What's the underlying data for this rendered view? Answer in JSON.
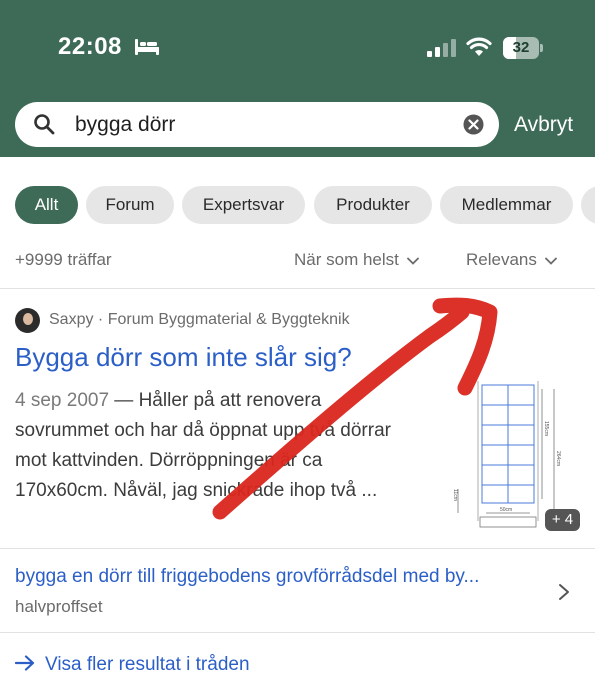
{
  "status_bar": {
    "time": "22:08",
    "battery": "32",
    "icons": [
      "bed-icon",
      "signal-icon",
      "wifi-icon",
      "battery-icon"
    ]
  },
  "search": {
    "query": "bygga dörr",
    "cancel_label": "Avbryt"
  },
  "filters": {
    "chips": [
      "Allt",
      "Forum",
      "Expertsvar",
      "Produkter",
      "Medlemmar"
    ],
    "active": "Allt"
  },
  "results_meta": {
    "hits": "+9999 träffar",
    "time_filter": "När som helst",
    "sort": "Relevans"
  },
  "result": {
    "author": "Saxpy",
    "source": "Saxpy · Forum Byggmaterial & Byggteknik",
    "title": "Bygga dörr som inte slår sig?",
    "date": "4 sep 2007",
    "snippet": " — Håller på att renovera sovrummet och har då öppnat upp två dörrar mot kattvinden. Dörröppningen är ca 170x60cm. Nåväl, jag snickrade ihop två ...",
    "image_count": "+ 4",
    "drawing_labels": [
      "155cm",
      "264cm",
      "11cm",
      "50cm"
    ]
  },
  "related": {
    "title": "bygga en dörr till friggebodens grovförrådsdel med by...",
    "source": "halvproffset"
  },
  "more": {
    "label": "Visa fler resultat i tråden"
  },
  "colors": {
    "header": "#3e6b58",
    "link": "#2b5fc7",
    "chip": "#e6e6e6",
    "annotation": "#d9261c"
  }
}
